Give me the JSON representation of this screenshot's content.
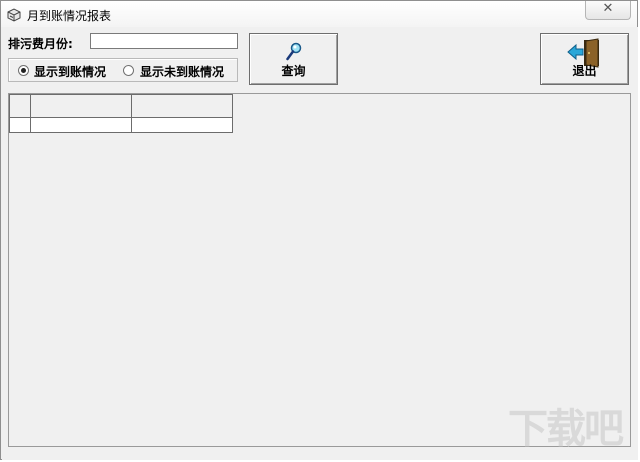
{
  "window": {
    "title": "月到账情况报表",
    "close_glyph": "✕"
  },
  "filter": {
    "month_label": "排污费月份:",
    "month_value": "",
    "radio_options": [
      {
        "label": "显示到账情况",
        "checked": true
      },
      {
        "label": "显示未到账情况",
        "checked": false
      }
    ]
  },
  "toolbar": {
    "query_label": "查询",
    "query_icon": "magnifier-icon",
    "exit_label": "退出",
    "exit_icon": "exit-door-icon"
  },
  "grid": {
    "columns": [
      "",
      ""
    ],
    "rows": [
      [
        "",
        ""
      ]
    ]
  },
  "watermark": {
    "text": "下载吧"
  },
  "colors": {
    "background": "#f0f0f0",
    "exit_arrow": "#2aa7d8",
    "door": "#6b4a1e"
  }
}
